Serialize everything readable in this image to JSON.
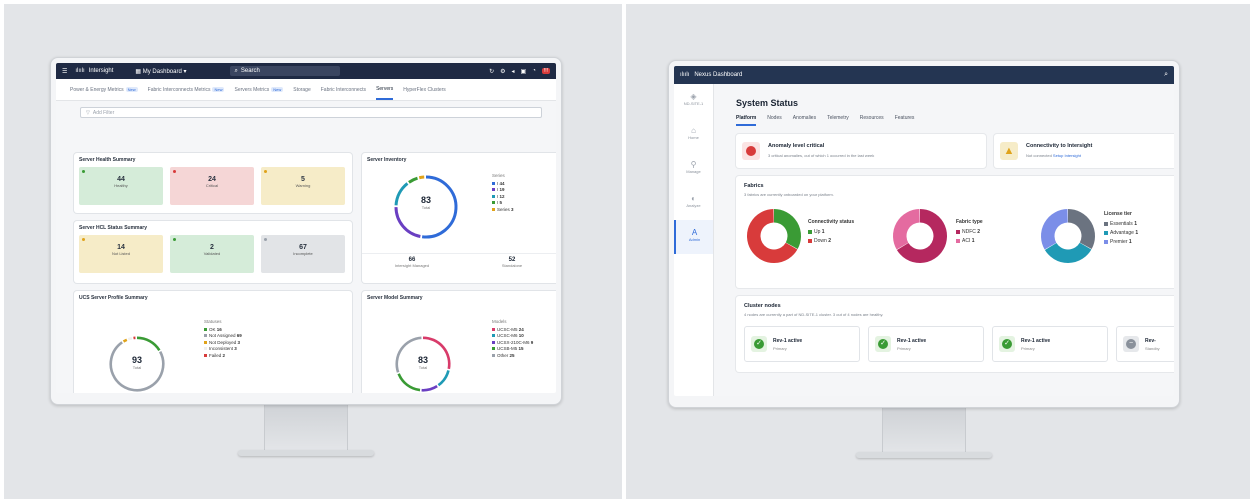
{
  "intersight": {
    "app_name": "Intersight",
    "dashboard_label": "My Dashboard",
    "search_placeholder": "Search",
    "tabs": [
      {
        "label": "Power & Energy Metrics",
        "badge": "New"
      },
      {
        "label": "Fabric Interconnects Metrics",
        "badge": "New"
      },
      {
        "label": "Servers Metrics",
        "badge": "New"
      },
      {
        "label": "Storage",
        "badge": ""
      },
      {
        "label": "Fabric Interconnects",
        "badge": ""
      },
      {
        "label": "Servers",
        "badge": ""
      },
      {
        "label": "HyperFlex Clusters",
        "badge": ""
      }
    ],
    "filter_placeholder": "Add Filter",
    "health": {
      "title": "Server Health Summary",
      "tiles": [
        {
          "value": "44",
          "label": "Healthy",
          "color": "#d5ecd9",
          "dot": "#3a9b35"
        },
        {
          "value": "24",
          "label": "Critical",
          "color": "#f5d6d6",
          "dot": "#d83b3b"
        },
        {
          "value": "5",
          "label": "Warning",
          "color": "#f6ecc8",
          "dot": "#e0a31a"
        }
      ]
    },
    "hcl": {
      "title": "Server HCL Status Summary",
      "tiles": [
        {
          "value": "14",
          "label": "Not Listed",
          "color": "#f6ecc8",
          "dot": "#e0a31a"
        },
        {
          "value": "2",
          "label": "Validated",
          "color": "#d5ecd9",
          "dot": "#3a9b35"
        },
        {
          "value": "67",
          "label": "Incomplete",
          "color": "#e2e4e7",
          "dot": "#9aa1ab"
        }
      ]
    },
    "inventory": {
      "title": "Server Inventory",
      "total": "83",
      "total_label": "Total",
      "legend_header": "Series",
      "legend": [
        {
          "label": "I",
          "value": "44",
          "color": "#2f6bd8"
        },
        {
          "label": "I",
          "value": "19",
          "color": "#6a3fc2"
        },
        {
          "label": "I",
          "value": "12",
          "color": "#1f9ab5"
        },
        {
          "label": "I",
          "value": "5",
          "color": "#3a9b35"
        },
        {
          "label": "Series",
          "value": "3",
          "color": "#e0a31a"
        }
      ],
      "bottom": [
        {
          "value": "66",
          "label": "Intersight Managed"
        },
        {
          "value": "52",
          "label": "Standalone"
        }
      ]
    },
    "profile": {
      "title": "UCS Server Profile Summary",
      "total": "93",
      "total_label": "Total",
      "legend_header": "Statuses",
      "legend": [
        {
          "label": "OK",
          "value": "16",
          "color": "#3a9b35"
        },
        {
          "label": "Not Assigned",
          "value": "69",
          "color": "#9aa1ab"
        },
        {
          "label": "Not Deployed",
          "value": "3",
          "color": "#e0a31a"
        },
        {
          "label": "Inconsistent",
          "value": "3",
          "color": "#f0f0f0"
        },
        {
          "label": "Failed",
          "value": "2",
          "color": "#d83b3b"
        }
      ]
    },
    "model": {
      "title": "Server Model Summary",
      "total": "83",
      "total_label": "Total",
      "legend_header": "Models",
      "legend": [
        {
          "label": "UCSC-M5",
          "value": "24",
          "color": "#d83b6a"
        },
        {
          "label": "UCSC-M6",
          "value": "10",
          "color": "#1f9ab5"
        },
        {
          "label": "UCSX-210C-M6",
          "value": "9",
          "color": "#6a3fc2"
        },
        {
          "label": "UCSB-M5",
          "value": "15",
          "color": "#3a9b35"
        },
        {
          "label": "Other",
          "value": "25",
          "color": "#9aa1ab"
        }
      ]
    }
  },
  "nexus": {
    "app_name": "Nexus Dashboard",
    "sidebar": [
      {
        "label": "ND-SITE-1",
        "icon": "site-icon"
      },
      {
        "label": "Home",
        "icon": "home-icon"
      },
      {
        "label": "Manage",
        "icon": "manage-icon"
      },
      {
        "label": "Analyze",
        "icon": "analyze-icon"
      },
      {
        "label": "Admin",
        "icon": "admin-icon"
      }
    ],
    "title": "System Status",
    "tabs": [
      "Platform",
      "Nodes",
      "Anomalies",
      "Telemetry",
      "Resources",
      "Features"
    ],
    "anomaly": {
      "title": "Anomaly level critical",
      "subtitle": "3 critical anomalies, out of which 1 occurred in the last week"
    },
    "connectivity": {
      "title": "Connectivity to Intersight",
      "subtitle": "Not connected",
      "link": "Setup Intersight"
    },
    "fabrics": {
      "title": "Fabrics",
      "subtitle": "3 fabrics are currently onboarded on your platform.",
      "charts": [
        {
          "title": "Connectivity status",
          "items": [
            {
              "label": "Up",
              "value": "1",
              "color": "#3a9b35"
            },
            {
              "label": "Down",
              "value": "2",
              "color": "#d83b3b"
            }
          ]
        },
        {
          "title": "Fabric type",
          "items": [
            {
              "label": "NDFC",
              "value": "2",
              "color": "#b5285f"
            },
            {
              "label": "ACI",
              "value": "1",
              "color": "#e46ba0"
            }
          ]
        },
        {
          "title": "License tier",
          "items": [
            {
              "label": "Essentials",
              "value": "1",
              "color": "#6b7380"
            },
            {
              "label": "Advantage",
              "value": "1",
              "color": "#1f9ab5"
            },
            {
              "label": "Premier",
              "value": "1",
              "color": "#7b8ee8"
            }
          ]
        }
      ]
    },
    "cluster": {
      "title": "Cluster nodes",
      "subtitle": "4 nodes are currently a part of ND-SITE-1 cluster. 3 out of 4 nodes are healthy.",
      "nodes": [
        {
          "name": "Rev-1 active",
          "role": "Primary"
        },
        {
          "name": "Rev-1 active",
          "role": "Primary"
        },
        {
          "name": "Rev-1 active",
          "role": "Primary"
        },
        {
          "name": "Rev-",
          "role": "Standby"
        }
      ]
    }
  }
}
